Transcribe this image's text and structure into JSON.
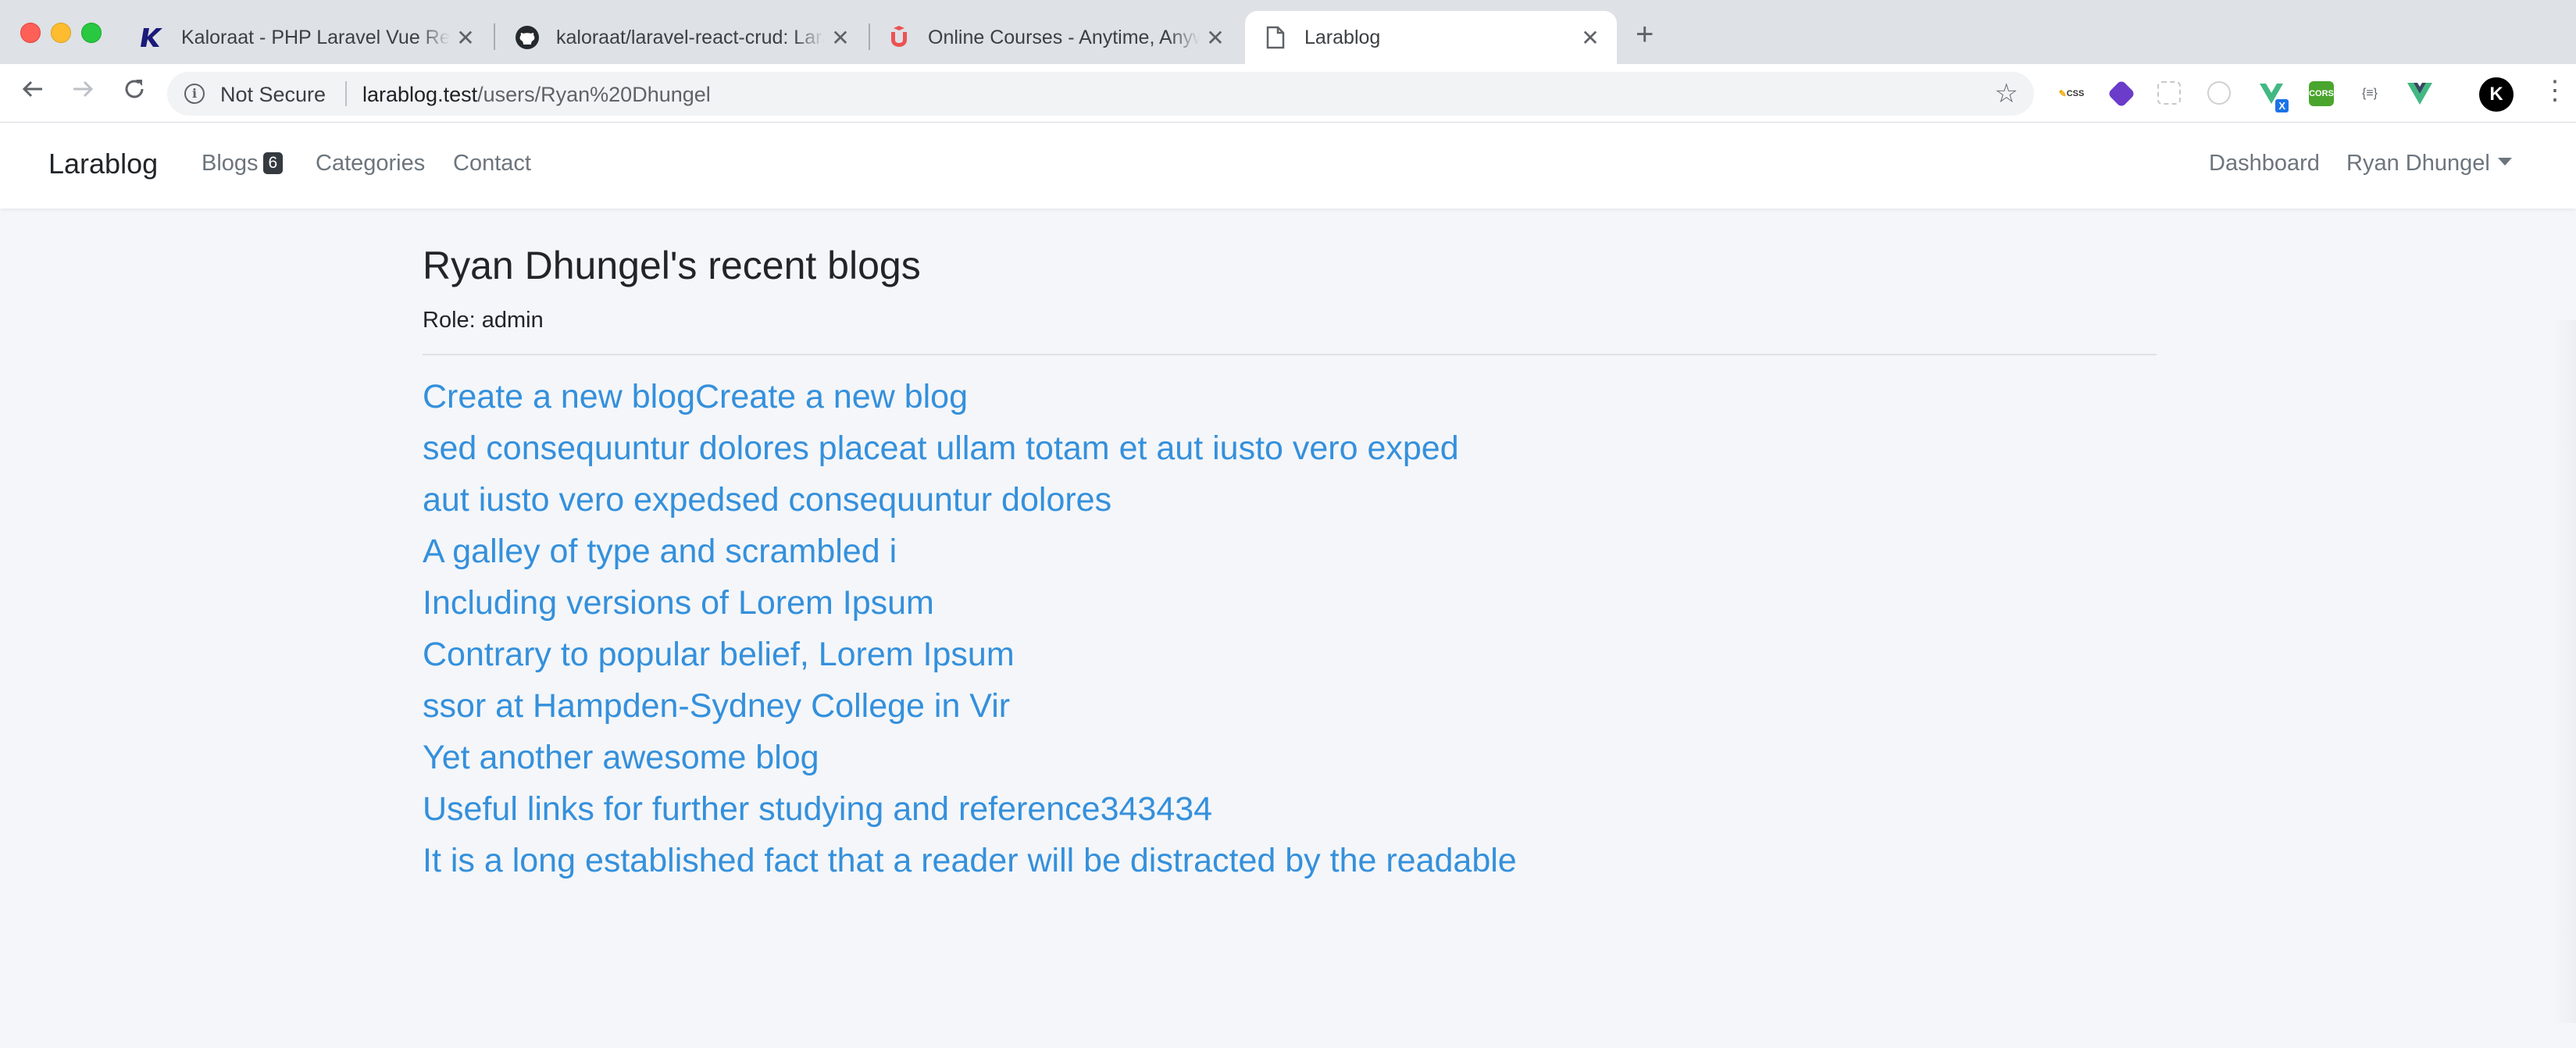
{
  "browser": {
    "tabs": [
      {
        "title": "Kaloraat - PHP Laravel Vue React Node",
        "icon": "kaloraat-k-icon",
        "active": false
      },
      {
        "title": "kaloraat/laravel-react-crud: Laravel React",
        "icon": "github-icon",
        "active": false
      },
      {
        "title": "Online Courses - Anytime, Anywhere",
        "icon": "udemy-icon",
        "active": false
      },
      {
        "title": "Larablog",
        "icon": "document-icon",
        "active": true
      }
    ],
    "address": {
      "security_label": "Not Secure",
      "url_host": "larablog.test",
      "url_path": "/users/Ryan%20Dhungel"
    },
    "extensions": [
      {
        "name": "css-extension-icon",
        "label": "CSS",
        "color": "#f2a900"
      },
      {
        "name": "cube-extension-icon",
        "label": "",
        "color": "#6a3cc9"
      },
      {
        "name": "grid-extension-icon",
        "label": "",
        "color": "#c8c8c8"
      },
      {
        "name": "clock-extension-icon",
        "label": "",
        "color": "#d0d0d0"
      },
      {
        "name": "vue-x-extension-icon",
        "label": "X",
        "color": "#42b883"
      },
      {
        "name": "cors-extension-icon",
        "label": "CORS",
        "color": "#4aa52e"
      },
      {
        "name": "json-extension-icon",
        "label": "{≡}",
        "color": "#5f6368"
      },
      {
        "name": "vue-devtools-icon",
        "label": "",
        "color": "#42b883"
      },
      {
        "name": "kaloraat-profile-icon",
        "label": "K",
        "color": "#000000"
      }
    ]
  },
  "navbar": {
    "brand": "Larablog",
    "links": {
      "blogs": "Blogs",
      "blogs_count": "6",
      "categories": "Categories",
      "contact": "Contact"
    },
    "right": {
      "dashboard": "Dashboard",
      "user": "Ryan Dhungel"
    }
  },
  "page": {
    "title": "Ryan Dhungel's recent blogs",
    "role": "Role: admin",
    "blogs": [
      "Create a new blogCreate a new blog",
      "sed consequuntur dolores placeat ullam totam et aut iusto vero exped",
      "aut iusto vero expedsed consequuntur dolores",
      "A galley of type and scrambled i",
      "Including versions of Lorem Ipsum",
      "Contrary to popular belief, Lorem Ipsum",
      "ssor at Hampden-Sydney College in Vir",
      "Yet another awesome blog",
      "Useful links for further studying and reference343434",
      "It is a long established fact that a reader will be distracted by the readable"
    ]
  },
  "colors": {
    "link": "#3490dc",
    "page_bg": "#f4f6f9",
    "badge": "#343a40"
  }
}
